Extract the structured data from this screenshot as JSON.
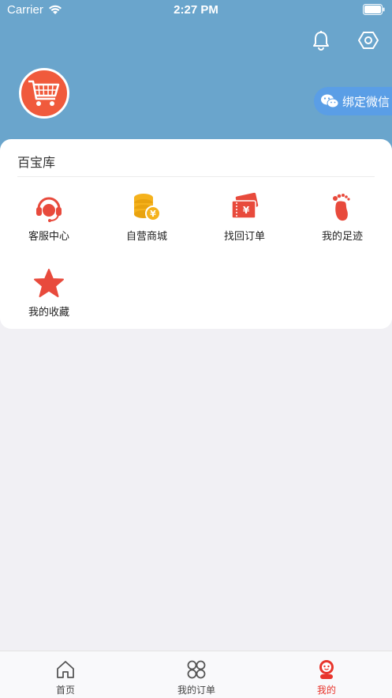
{
  "status_bar": {
    "carrier": "Carrier",
    "time": "2:27 PM"
  },
  "header": {
    "bind_wechat_label": "绑定微信"
  },
  "card": {
    "title": "百宝库",
    "items": [
      {
        "label": "客服中心",
        "icon": "headset-icon"
      },
      {
        "label": "自营商城",
        "icon": "coins-icon"
      },
      {
        "label": "找回订单",
        "icon": "ticket-icon"
      },
      {
        "label": "我的足迹",
        "icon": "footprint-icon"
      },
      {
        "label": "我的收藏",
        "icon": "star-icon"
      }
    ]
  },
  "tabbar": {
    "tabs": [
      {
        "label": "首页",
        "icon": "home-icon"
      },
      {
        "label": "我的订单",
        "icon": "grid-icon"
      },
      {
        "label": "我的",
        "icon": "profile-icon"
      }
    ],
    "active_index": 2
  },
  "colors": {
    "header_bg": "#6aa5cc",
    "accent_red": "#e8352c",
    "wechat_button": "#5a9ee6"
  }
}
